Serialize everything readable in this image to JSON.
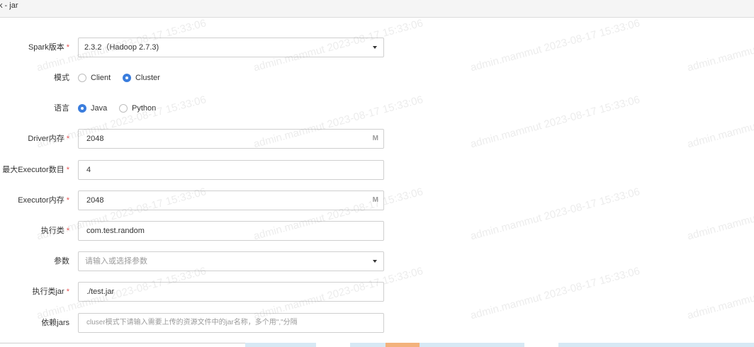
{
  "window": {
    "title": "k - jar"
  },
  "form": {
    "spark_version": {
      "label": "Spark版本",
      "required_mark": "*",
      "value": "2.3.2（Hadoop 2.7.3)"
    },
    "mode": {
      "label": "模式",
      "options": [
        {
          "label": "Client",
          "checked": false
        },
        {
          "label": "Cluster",
          "checked": true
        }
      ]
    },
    "language": {
      "label": "语言",
      "options": [
        {
          "label": "Java",
          "checked": true
        },
        {
          "label": "Python",
          "checked": false
        }
      ]
    },
    "driver_memory": {
      "label": "Driver内存",
      "required_mark": "*",
      "value": "2048",
      "suffix": "M"
    },
    "max_executors": {
      "label": "最大Executor数目",
      "required_mark": "*",
      "value": "4"
    },
    "executor_memory": {
      "label": "Executor内存",
      "required_mark": "*",
      "value": "2048",
      "suffix": "M"
    },
    "main_class": {
      "label": "执行类",
      "required_mark": "*",
      "value": "com.test.random"
    },
    "params": {
      "label": "参数",
      "placeholder": "请输入或选择参数"
    },
    "main_jar": {
      "label": "执行类jar",
      "required_mark": "*",
      "value": "./test.jar"
    },
    "dependency_jars": {
      "label": "依赖jars",
      "placeholder": "cluser模式下请输入需要上传的资源文件中的jar名称，多个用\",\"分隔"
    }
  },
  "watermark": {
    "text": "admin.mammut 2023-08-17 15:33:06"
  },
  "colors": {
    "accent": "#3b7ddd",
    "required": "#e65252",
    "strip_blue": "#d7e9f5",
    "strip_orange": "#f3b27c"
  }
}
